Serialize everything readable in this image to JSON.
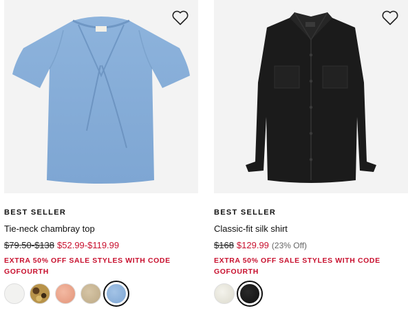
{
  "products": [
    {
      "badge": "BEST SELLER",
      "name": "Tie-neck chambray top",
      "price_original": "$79.50-$138",
      "price_sale": "$52.99-$119.99",
      "price_off": "",
      "promo": "EXTRA 50% OFF SALE STYLES WITH CODE GOFOURTH",
      "wishlist_icon": "heart-outline-icon",
      "swatches": [
        {
          "name": "white",
          "color": "#f2f2f0"
        },
        {
          "name": "print",
          "color": "#b8934a"
        },
        {
          "name": "peach",
          "color": "#e9a48b"
        },
        {
          "name": "khaki",
          "color": "#c8b594"
        },
        {
          "name": "chambray",
          "color": "#8fb4de",
          "selected": true
        }
      ]
    },
    {
      "badge": "BEST SELLER",
      "name": "Classic-fit silk shirt",
      "price_original": "$168",
      "price_sale": "$129.99",
      "price_off": "(23% Off)",
      "promo": "EXTRA 50% OFF SALE STYLES WITH CODE GOFOURTH",
      "wishlist_icon": "heart-outline-icon",
      "swatches": [
        {
          "name": "ivory",
          "color": "#ecebe2"
        },
        {
          "name": "black",
          "color": "#151515",
          "selected": true
        }
      ]
    }
  ],
  "colors": {
    "sale_red": "#c8102e",
    "image_bg": "#f3f3f3"
  }
}
